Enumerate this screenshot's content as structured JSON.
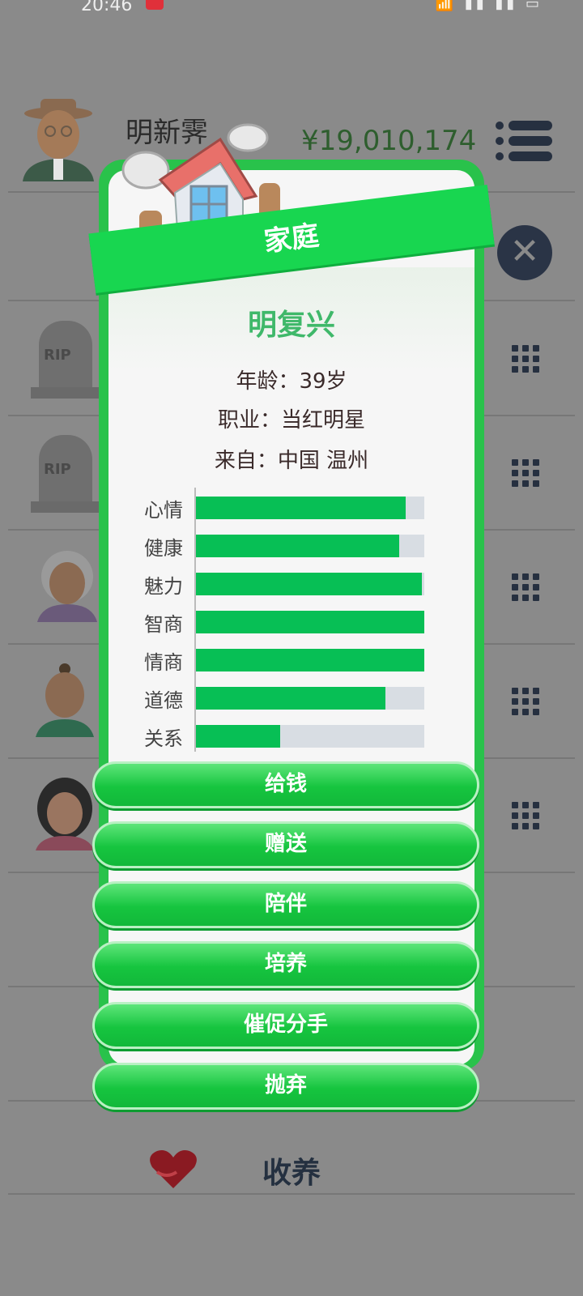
{
  "status_bar": {
    "time": "20:46",
    "system_icons": "wifi 4G signal signal battery"
  },
  "header": {
    "player_name": "明新霁",
    "money": "¥19,010,174",
    "menu_icon": "list-menu-icon"
  },
  "family_list": [
    {
      "type": "tombstone",
      "icon": "rip-tombstone-icon",
      "rip_text": "RIP"
    },
    {
      "type": "tombstone",
      "icon": "rip-tombstone-icon",
      "rip_text": "RIP"
    },
    {
      "type": "person",
      "icon": "grandmother-avatar"
    },
    {
      "type": "person",
      "icon": "man-avatar"
    },
    {
      "type": "person",
      "icon": "woman-avatar"
    }
  ],
  "adopt": {
    "label": "收养",
    "icon": "heart-hands-icon"
  },
  "modal": {
    "banner_title": "家庭",
    "person_name": "明复兴",
    "age_line": "年龄：39岁",
    "job_line": "职业：当红明星",
    "from_line": "来自：中国 温州",
    "stats": [
      {
        "label": "心情",
        "value": 0.92
      },
      {
        "label": "健康",
        "value": 0.89
      },
      {
        "label": "魅力",
        "value": 0.99
      },
      {
        "label": "智商",
        "value": 1.0
      },
      {
        "label": "情商",
        "value": 1.0
      },
      {
        "label": "道德",
        "value": 0.83
      },
      {
        "label": "关系",
        "value": 0.37
      }
    ],
    "actions": [
      "给钱",
      "赠送",
      "陪伴",
      "培养",
      "催促分手",
      "抛弃"
    ],
    "close_icon": "close-x-icon"
  },
  "colors": {
    "accent_green": "#18d650",
    "bar_green": "#07bf55",
    "money_green": "#2e5e2e",
    "name_green": "#3fb86a"
  }
}
